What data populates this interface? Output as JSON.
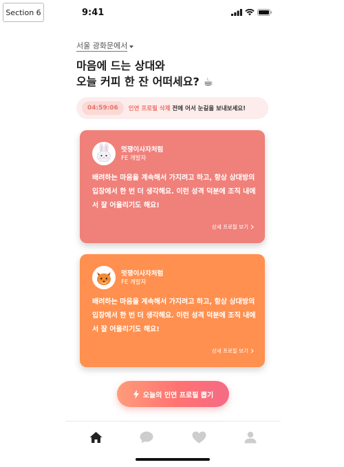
{
  "section_label": "Section 6",
  "status_bar": {
    "time": "9:41"
  },
  "location": {
    "label": "서울 광화문에서"
  },
  "headline": {
    "line1": "마음에 드는 상대와",
    "line2": "오늘 커피 한 잔 어떠세요? ☕"
  },
  "timer_banner": {
    "countdown": "04:59:06",
    "accent_text": "인연 프로필 삭제",
    "message": " 전에 어서 눈길을 보내보세요!"
  },
  "cards": [
    {
      "name": "멋쟁이사자처럼",
      "role": "FE 개발자",
      "body": "배려하는 마음을 계속해서 가지려고 하고, 항상 상대방의 입장에서 한 번 더 생각해요. 이런 성격 덕분에 조직 내에서 잘 어울리기도 해요!",
      "link": "상세 프로필 보기",
      "avatar": "rabbit-avatar",
      "color": "#f0807a"
    },
    {
      "name": "멋쟁이사자처럼",
      "role": "FE 개발자",
      "body": "배려하는 마음을 계속해서 가지려고 하고, 항상 상대방의 입장에서 한 번 더 생각해요. 이런 성격 덕분에 조직 내에서 잘 어울리기도 해요!",
      "link": "상세 프로필 보기",
      "avatar": "fox-avatar",
      "color": "#ff904f"
    }
  ],
  "cta": {
    "label": "오늘의 인연 프로필 뽑기",
    "icon": "lightning-icon"
  },
  "tab_bar": {
    "items": [
      {
        "icon": "home-icon",
        "active": true
      },
      {
        "icon": "chat-icon",
        "active": false
      },
      {
        "icon": "heart-icon",
        "active": false
      },
      {
        "icon": "profile-icon",
        "active": false
      }
    ]
  }
}
